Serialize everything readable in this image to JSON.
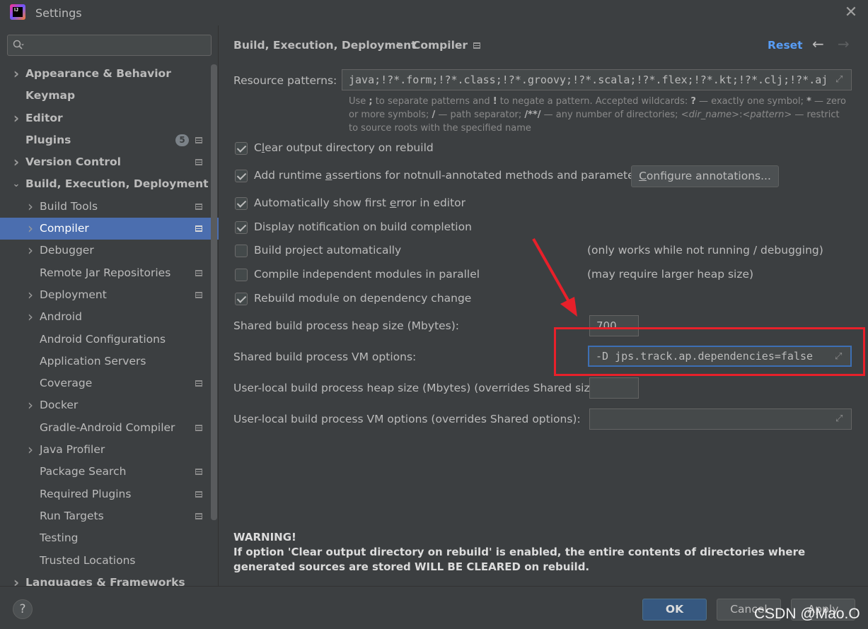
{
  "window": {
    "title": "Settings",
    "logo_text": "IJ"
  },
  "search": {
    "placeholder": ""
  },
  "sidebar": {
    "items": [
      {
        "label": "Appearance & Behavior",
        "level": 0,
        "bold": true,
        "expandable": true
      },
      {
        "label": "Keymap",
        "level": 0,
        "bold": true,
        "expandable": false
      },
      {
        "label": "Editor",
        "level": 0,
        "bold": true,
        "expandable": true
      },
      {
        "label": "Plugins",
        "level": 0,
        "bold": true,
        "expandable": false,
        "badge": "5",
        "project_icon": true
      },
      {
        "label": "Version Control",
        "level": 0,
        "bold": true,
        "expandable": true,
        "project_icon": true
      },
      {
        "label": "Build, Execution, Deployment",
        "level": 0,
        "bold": true,
        "expandable": true,
        "expanded": true
      },
      {
        "label": "Build Tools",
        "level": 1,
        "expandable": true,
        "project_icon": true
      },
      {
        "label": "Compiler",
        "level": 1,
        "expandable": true,
        "project_icon": true,
        "selected": true
      },
      {
        "label": "Debugger",
        "level": 1,
        "expandable": true
      },
      {
        "label": "Remote Jar Repositories",
        "level": 1,
        "expandable": false,
        "project_icon": true
      },
      {
        "label": "Deployment",
        "level": 1,
        "expandable": true,
        "project_icon": true
      },
      {
        "label": "Android",
        "level": 1,
        "expandable": true
      },
      {
        "label": "Android Configurations",
        "level": 1,
        "expandable": false
      },
      {
        "label": "Application Servers",
        "level": 1,
        "expandable": false
      },
      {
        "label": "Coverage",
        "level": 1,
        "expandable": false,
        "project_icon": true
      },
      {
        "label": "Docker",
        "level": 1,
        "expandable": true
      },
      {
        "label": "Gradle-Android Compiler",
        "level": 1,
        "expandable": false,
        "project_icon": true
      },
      {
        "label": "Java Profiler",
        "level": 1,
        "expandable": true
      },
      {
        "label": "Package Search",
        "level": 1,
        "expandable": false,
        "project_icon": true
      },
      {
        "label": "Required Plugins",
        "level": 1,
        "expandable": false,
        "project_icon": true
      },
      {
        "label": "Run Targets",
        "level": 1,
        "expandable": false,
        "project_icon": true
      },
      {
        "label": "Testing",
        "level": 1,
        "expandable": false
      },
      {
        "label": "Trusted Locations",
        "level": 1,
        "expandable": false
      },
      {
        "label": "Languages & Frameworks",
        "level": 0,
        "bold": true,
        "expandable": true
      }
    ]
  },
  "header": {
    "crumb1": "Build, Execution, Deployment",
    "separator": "›",
    "crumb2": "Compiler",
    "reset": "Reset",
    "back": "←",
    "forward": "→"
  },
  "compiler": {
    "resource_patterns_label": "Resource patterns:",
    "resource_patterns_value": "java;!?*.form;!?*.class;!?*.groovy;!?*.scala;!?*.flex;!?*.kt;!?*.clj;!?*.aj",
    "hint_1": "Use ",
    "hint_2": ";",
    "hint_3": " to separate patterns and ",
    "hint_4": "!",
    "hint_5": " to negate a pattern. Accepted wildcards: ",
    "hint_6": "?",
    "hint_7": " — exactly one symbol; ",
    "hint_8": "*",
    "hint_9": " — zero or more symbols; ",
    "hint_10": "/",
    "hint_11": " — path separator; ",
    "hint_12": "/**/",
    "hint_13": " — any number of directories; ",
    "hint_14": "<dir_name>",
    "hint_15": ":",
    "hint_16": "<pattern>",
    "hint_17": " — restrict to source roots with the specified name",
    "options": [
      {
        "pre": "C",
        "ul": "l",
        "post": "ear output directory on rebuild",
        "checked": true
      },
      {
        "pre": "Add runtime ",
        "ul": "a",
        "post": "ssertions for notnull-annotated methods and parameters",
        "checked": true
      },
      {
        "pre": "Automatically show first ",
        "ul": "e",
        "post": "rror in editor",
        "checked": true
      },
      {
        "pre": "Display notification on build completion",
        "ul": "",
        "post": "",
        "checked": true
      },
      {
        "pre": "Build project automatically",
        "ul": "",
        "post": "",
        "checked": false,
        "note": "(only works while not running / debugging)"
      },
      {
        "pre": "Compile independent modules in parallel",
        "ul": "",
        "post": "",
        "checked": false,
        "note": "(may require larger heap size)"
      },
      {
        "pre": "Rebuild module on dependency change",
        "ul": "",
        "post": "",
        "checked": true
      }
    ],
    "configure_btn_ul": "C",
    "configure_btn_rest": "onfigure annotations...",
    "heap_label": "Shared build process heap size (Mbytes):",
    "heap_value": "700",
    "vm_label": "Shared build process VM options:",
    "vm_value": "-D jps.track.ap.dependencies=false",
    "local_heap_label": "User-local build process heap size (Mbytes) (overrides Shared size):",
    "local_heap_value": "",
    "local_vm_label": "User-local build process VM options (overrides Shared options):",
    "local_vm_value": "",
    "warning_title": "WARNING!",
    "warning_text": "If option 'Clear output directory on rebuild' is enabled, the entire contents of directories where generated sources are stored WILL BE CLEARED on rebuild."
  },
  "footer": {
    "help": "?",
    "ok": "OK",
    "cancel": "Cancel",
    "apply": "Apply",
    "watermark": "CSDN @Mao.O"
  },
  "colors": {
    "background": "#3c3f41",
    "selection": "#4b6eaf",
    "link": "#589df6",
    "ok_button": "#365880",
    "annotation_red": "#e8202a"
  },
  "icons": [
    "app-logo",
    "search-icon",
    "close-icon",
    "chevron-right-icon",
    "chevron-down-icon",
    "project-level-icon",
    "expand-icon",
    "back-arrow-icon",
    "forward-arrow-icon",
    "help-icon",
    "checkbox"
  ]
}
